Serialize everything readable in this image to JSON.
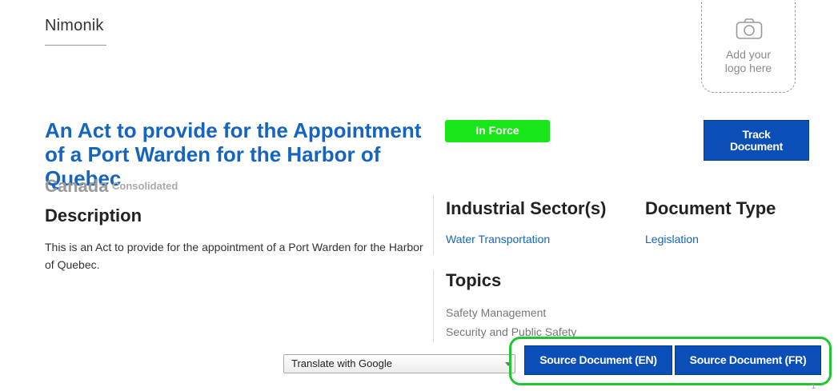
{
  "brand": {
    "name": "Nimonik"
  },
  "logo_placeholder": {
    "icon": "camera-icon",
    "text_line1": "Add your",
    "text_line2": "logo here"
  },
  "document": {
    "title": "An Act to provide for the Appointment of a Port Warden for the Harbor of Quebec",
    "status": "In Force",
    "country": "Canada",
    "version": "Consolidated",
    "track_label": "Track Document"
  },
  "description": {
    "heading": "Description",
    "text": "This is an Act to provide for the appointment of a Port Warden for the Harbor of Quebec."
  },
  "sector": {
    "heading": "Industrial Sector(s)",
    "value": "Water Transportation"
  },
  "doctype": {
    "heading": "Document Type",
    "value": "Legislation"
  },
  "topics": {
    "heading": "Topics",
    "items": [
      "Safety Management",
      "Security and Public Safety"
    ]
  },
  "translate": {
    "label": "Translate with Google"
  },
  "source": {
    "en_label": "Source Document (EN)",
    "fr_label": "Source Document (FR)"
  },
  "footer_mark": "1",
  "colors": {
    "accent": "#1565c0",
    "status_green": "#19e619",
    "button_blue": "#0a4fb8",
    "highlight_green": "#22c531"
  }
}
